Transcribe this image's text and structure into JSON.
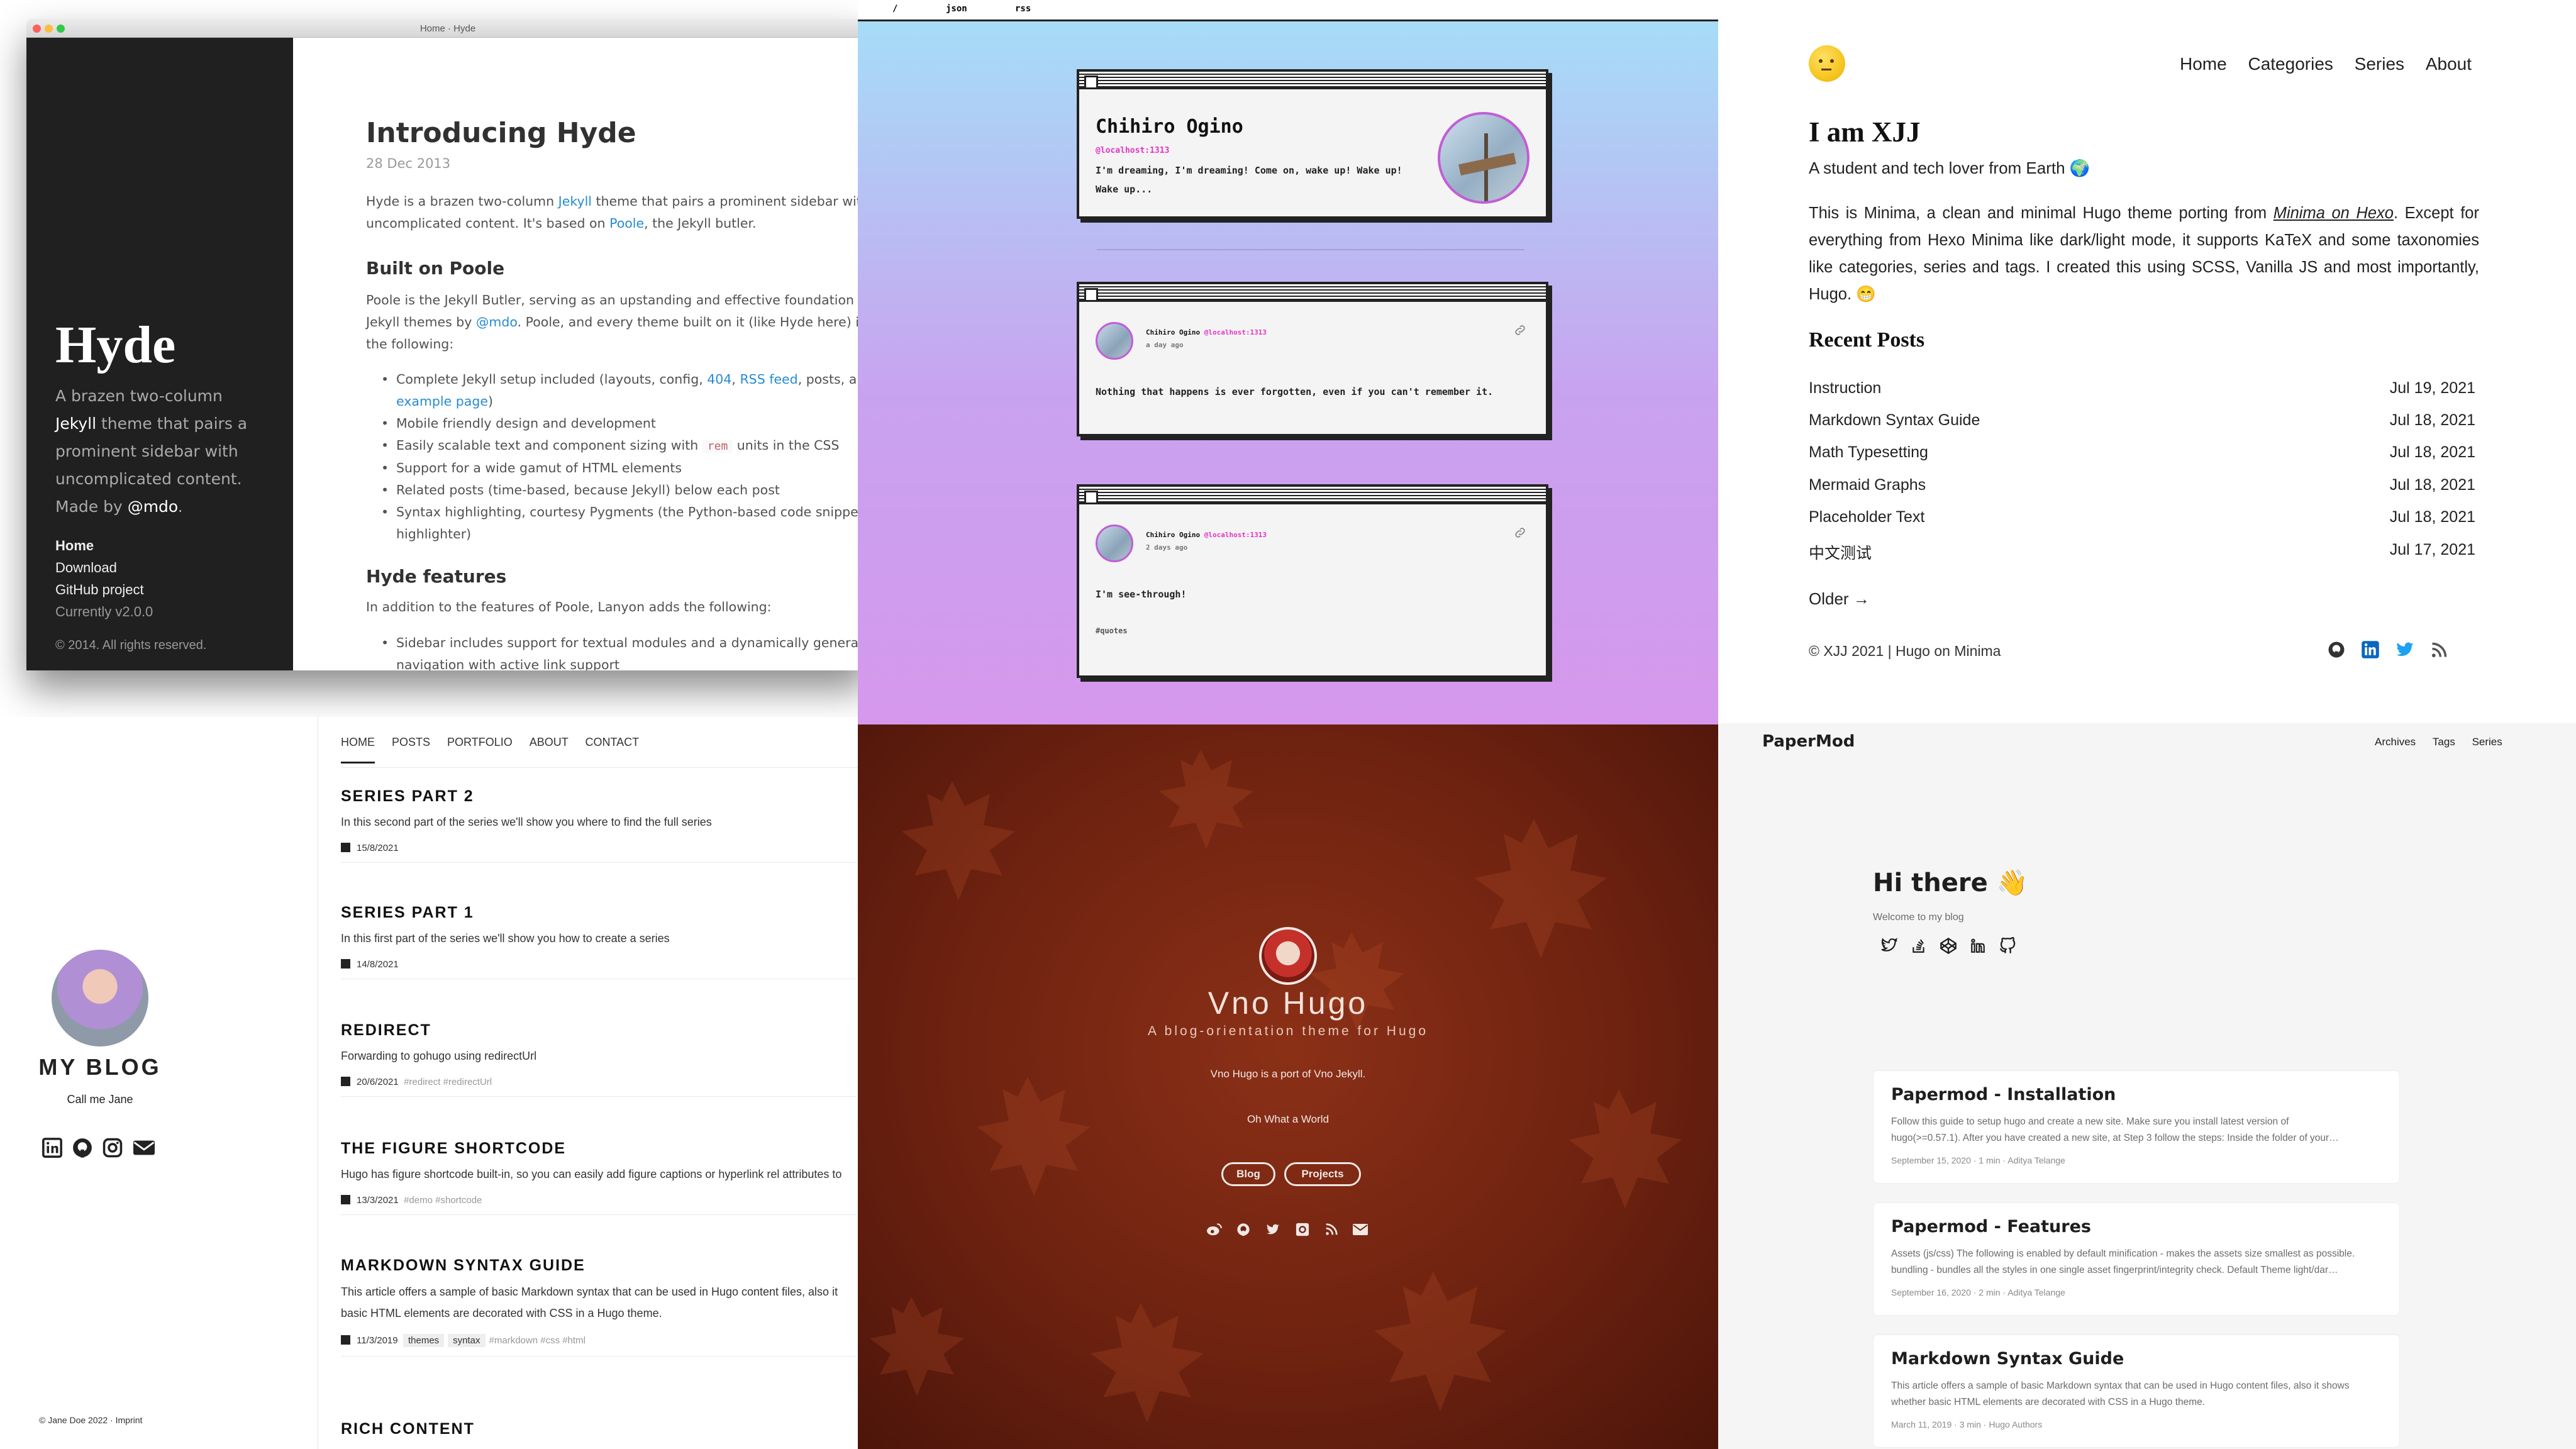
{
  "hyde": {
    "window_title": "Home · Hyde",
    "sidebar": {
      "title": "Hyde",
      "lead_1": "A brazen two-column",
      "lead_link": "Jekyll",
      "lead_2": " theme that pairs a prominent sidebar with uncomplicated content. Made by ",
      "lead_author": "@mdo",
      "lead_end": ".",
      "nav": [
        "Home",
        "Download",
        "GitHub project"
      ],
      "version": "Currently v2.0.0",
      "copyright": "© 2014. All rights reserved."
    },
    "post": {
      "title": "Introducing Hyde",
      "date": "28 Dec 2013",
      "intro_1": "Hyde is a brazen two-column ",
      "intro_link1": "Jekyll",
      "intro_2": " theme that pairs a prominent sidebar with",
      "intro_3": "uncomplicated content. It's based on ",
      "intro_link2": "Poole",
      "intro_4": ", the Jekyll butler.",
      "h2_poole": "Built on Poole",
      "poole_1": "Poole is the Jekyll Butler, serving as an upstanding and effective foundation for",
      "poole_2a": "Jekyll themes by ",
      "poole_link": "@mdo",
      "poole_2b": ". Poole, and every theme built on it (like Hyde here) in",
      "poole_3": "the following:",
      "list1": {
        "item1_a": "Complete Jekyll setup included (layouts, config, ",
        "item1_l1": "404",
        "item1_b": ", ",
        "item1_l2": "RSS feed",
        "item1_c": ", posts, and",
        "item1_l3": "example page",
        "item1_d": ")",
        "item2": "Mobile friendly design and development",
        "item3_a": "Easily scalable text and component sizing with ",
        "item3_code": "rem",
        "item3_b": " units in the CSS",
        "item4": "Support for a wide gamut of HTML elements",
        "item5": "Related posts (time-based, because Jekyll) below each post",
        "item6_a": "Syntax highlighting, courtesy Pygments (the Python-based code snippet",
        "item6_b": "highlighter)"
      },
      "h2_features": "Hyde features",
      "features_intro": "In addition to the features of Poole, Lanyon adds the following:",
      "feat1_a": "Sidebar includes support for textual modules and a dynamically generate",
      "feat1_b": "navigation with active link support"
    }
  },
  "retro": {
    "topnav": [
      "/",
      "json",
      "rss"
    ],
    "profile": {
      "name": "Chihiro Ogino",
      "handle": "@localhost:1313",
      "bio_1": "I'm dreaming, I'm dreaming! Come on, wake up! Wake up!",
      "bio_2": "Wake up..."
    },
    "posts": [
      {
        "name": "Chihiro Ogino",
        "handle": "@localhost:1313",
        "time": "a day ago",
        "text": "Nothing that happens is ever forgotten, even if you can't remember it.",
        "tag": ""
      },
      {
        "name": "Chihiro Ogino",
        "handle": "@localhost:1313",
        "time": "2 days ago",
        "text": "I'm see-through!",
        "tag": "#quotes"
      }
    ]
  },
  "minima": {
    "nav": [
      "Home",
      "Categories",
      "Series",
      "About"
    ],
    "title": "I am XJJ",
    "subtitle": "A student and tech lover from Earth 🌍",
    "intro_a": "This is Minima, a clean and minimal Hugo theme porting from ",
    "intro_link": "Minima on Hexo",
    "intro_b": ".",
    "intro_2": "Except for everything from Hexo Minima like dark/light mode, it supports KaTeX and",
    "intro_3": "some taxonomies like categories, series and tags. I created this using SCSS, Vanilla",
    "intro_4": "JS and most importantly, Hugo. 😁",
    "recent_heading": "Recent Posts",
    "posts": [
      {
        "title": "Instruction",
        "date": "Jul 19, 2021"
      },
      {
        "title": "Markdown Syntax Guide",
        "date": "Jul 18, 2021"
      },
      {
        "title": "Math Typesetting",
        "date": "Jul 18, 2021"
      },
      {
        "title": "Mermaid Graphs",
        "date": "Jul 18, 2021"
      },
      {
        "title": "Placeholder Text",
        "date": "Jul 18, 2021"
      },
      {
        "title": "中文测试",
        "date": "Jul 17, 2021"
      }
    ],
    "older": "Older →",
    "footer": "© XJJ 2021 | Hugo on Minima",
    "icon_colors": {
      "github": "#333333",
      "linkedin": "#0a66c2",
      "twitter": "#1da1f2",
      "rss": "#555555"
    }
  },
  "blog": {
    "nav": [
      "HOME",
      "POSTS",
      "PORTFOLIO",
      "ABOUT",
      "CONTACT"
    ],
    "site_title": "MY BLOG",
    "tagline": "Call me Jane",
    "footer": "© Jane Doe 2022 · Imprint",
    "posts": [
      {
        "title": "SERIES PART 2",
        "summary": "In this second part of the series we'll show you where to find the full series",
        "date": "15/8/2021",
        "tags": "",
        "pill1": "",
        "pill2": ""
      },
      {
        "title": "SERIES PART 1",
        "summary": "In this first part of the series we'll show you how to create a series",
        "date": "14/8/2021",
        "tags": "",
        "pill1": "",
        "pill2": ""
      },
      {
        "title": "REDIRECT",
        "summary": "Forwarding to gohugo using redirectUrl",
        "date": "20/6/2021",
        "tags": "#redirect #redirectUrl",
        "pill1": "",
        "pill2": ""
      },
      {
        "title": "THE FIGURE SHORTCODE",
        "summary": "Hugo has figure shortcode built-in, so you can easily add figure captions or hyperlink rel attributes to",
        "date": "13/3/2021",
        "tags": "#demo #shortcode",
        "pill1": "",
        "pill2": ""
      },
      {
        "title": "MARKDOWN SYNTAX GUIDE",
        "summary": "This article offers a sample of basic Markdown syntax that can be used in Hugo content files, also it",
        "summary2": "basic HTML elements are decorated with CSS in a Hugo theme.",
        "date": "11/3/2019",
        "tags": "#markdown #css #html",
        "pill1": "themes",
        "pill2": "syntax"
      }
    ],
    "last_title": "RICH CONTENT"
  },
  "vno": {
    "title": "Vno Hugo",
    "subtitle": "A blog-orientation theme for Hugo",
    "desc": "Vno Hugo is a port of Vno Jekyll.",
    "tagline": "Oh What a World",
    "buttons": [
      "Blog",
      "Projects"
    ]
  },
  "papermod": {
    "brand": "PaperMod",
    "nav": [
      "Archives",
      "Tags",
      "Series"
    ],
    "greeting": "Hi there 👋",
    "welcome": "Welcome to my blog",
    "posts": [
      {
        "title": "Papermod - Installation",
        "ex1": "Follow this guide to setup hugo and create a new site. Make sure you install latest version of",
        "ex2": "hugo(>=0.57.1). After you have created a new site, at Step 3 follow the steps: Inside the folder of your…",
        "meta": "September 15, 2020 · 1 min · Aditya Telange"
      },
      {
        "title": "Papermod - Features",
        "ex1": "Assets (js/css) The following is enabled by default minification - makes the assets size smallest as possible.",
        "ex2": "bundling - bundles all the styles in one single asset fingerprint/integrity check. Default Theme light/dar…",
        "meta": "September 16, 2020 · 2 min · Aditya Telange"
      },
      {
        "title": "Markdown Syntax Guide",
        "ex1": "This article offers a sample of basic Markdown syntax that can be used in Hugo content files, also it shows",
        "ex2": "whether basic HTML elements are decorated with CSS in a Hugo theme.",
        "meta": "March 11, 2019 · 3 min · Hugo Authors"
      }
    ]
  }
}
